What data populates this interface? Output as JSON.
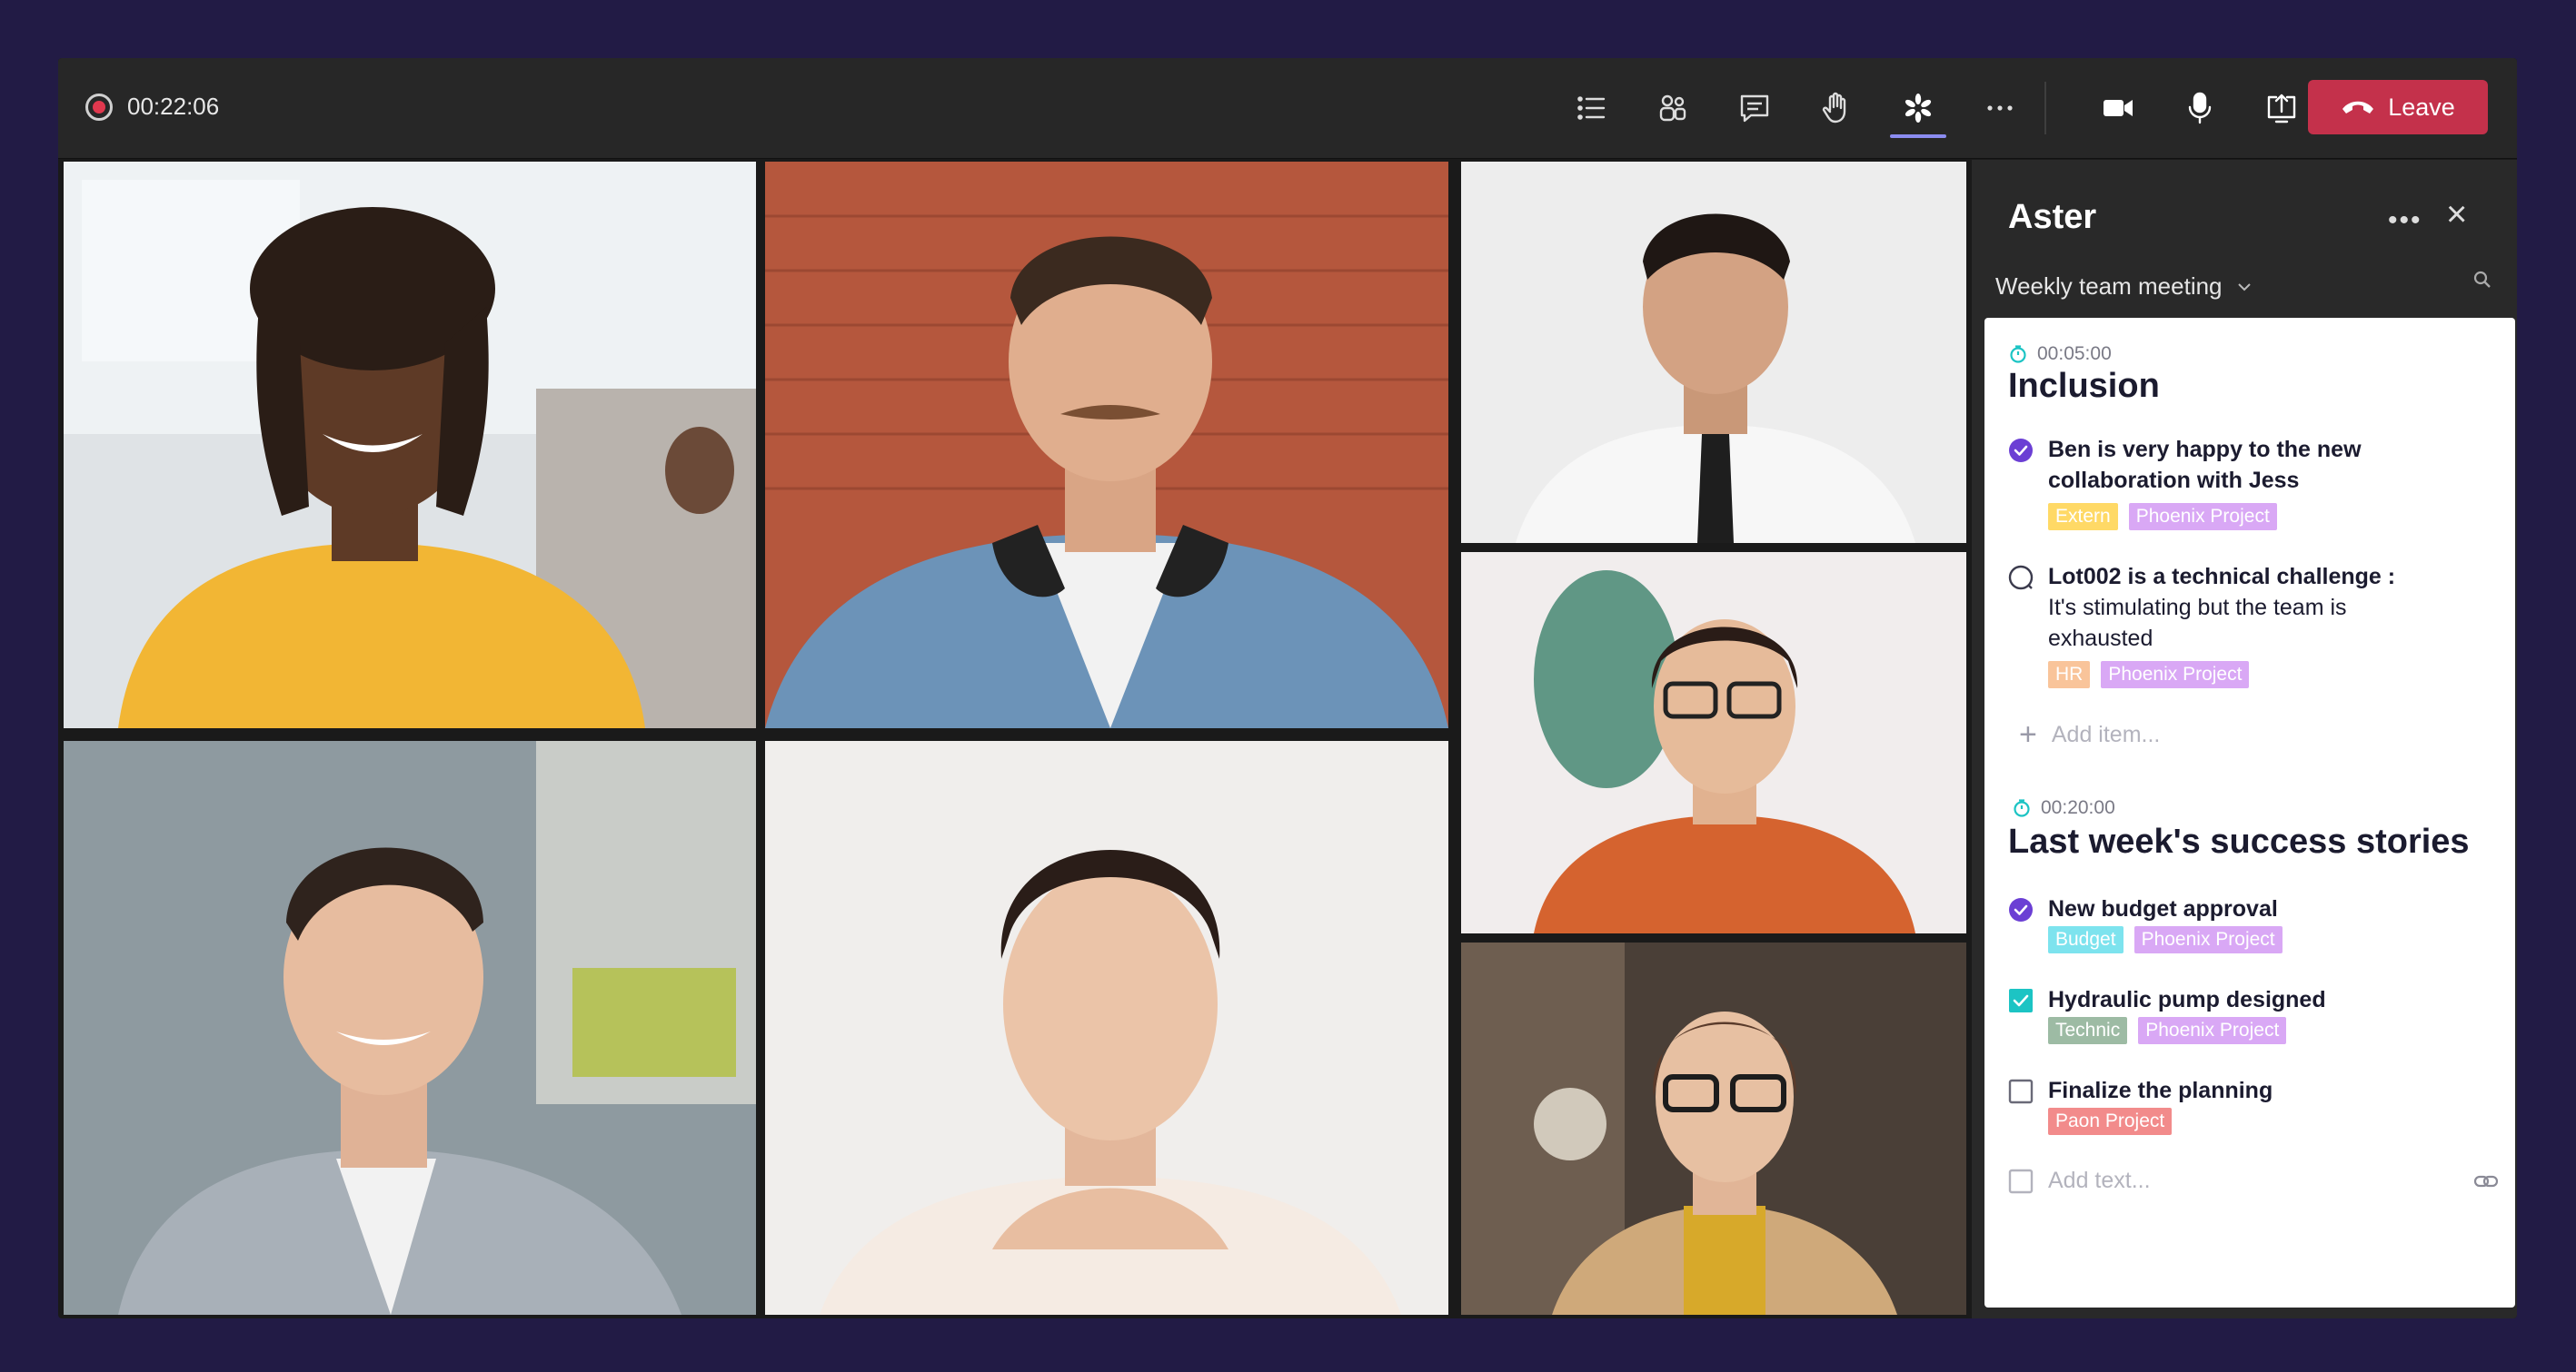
{
  "topbar": {
    "record_time": "00:22:06",
    "leave_label": "Leave",
    "icons": [
      "list-icon",
      "people-icon",
      "chat-icon",
      "raise-hand-icon",
      "aster-app-icon",
      "more-icon",
      "camera-icon",
      "mic-icon",
      "share-screen-icon"
    ]
  },
  "panel": {
    "title": "Aster",
    "meeting": "Weekly team meeting",
    "sections": [
      {
        "timer": "00:05:00",
        "title": "Inclusion",
        "items": [
          {
            "bold": "Ben is very happy to the new collaboration with Jess",
            "rest": "",
            "status": "done-circle",
            "tags": [
              {
                "label": "Extern",
                "color": "#ffd966"
              },
              {
                "label": "Phoenix Project",
                "color": "#d9a8f5"
              }
            ]
          },
          {
            "bold": "Lot002 is a technical challenge :",
            "rest": "It's stimulating but the team is exhausted",
            "status": "open-circle",
            "tags": [
              {
                "label": "HR",
                "color": "#f9c49a"
              },
              {
                "label": "Phoenix Project",
                "color": "#d9a8f5"
              }
            ]
          }
        ],
        "add_placeholder": "Add item..."
      },
      {
        "timer": "00:20:00",
        "title": "Last week's success stories",
        "items": [
          {
            "bold": "New budget approval",
            "status": "done-circle",
            "tags": [
              {
                "label": "Budget",
                "color": "#7de3ee"
              },
              {
                "label": "Phoenix Project",
                "color": "#d9a8f5"
              }
            ]
          },
          {
            "bold": "Hydraulic pump designed",
            "status": "checked-box",
            "tags": [
              {
                "label": "Technic",
                "color": "#9dbba4"
              },
              {
                "label": "Phoenix Project",
                "color": "#d9a8f5"
              }
            ]
          },
          {
            "bold": "Finalize the planning",
            "status": "empty-box",
            "tags": [
              {
                "label": "Paon Project",
                "color": "#f28b8b"
              }
            ]
          }
        ],
        "add_placeholder": "Add text..."
      }
    ]
  },
  "colors": {
    "accent": "#6b3fd4",
    "leave": "#c4314b",
    "check_teal": "#1cc4c4",
    "timer": "#1cc4c4"
  }
}
